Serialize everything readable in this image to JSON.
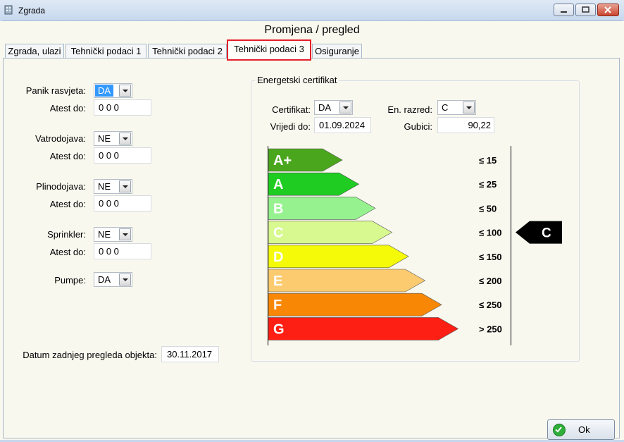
{
  "window": {
    "title": "Zgrada"
  },
  "form_title": "Promjena / pregled",
  "tabs": [
    {
      "label": "Zgrada, ulazi"
    },
    {
      "label": "Tehnički podaci 1"
    },
    {
      "label": "Tehnički podaci 2"
    },
    {
      "label": "Tehnički podaci 3"
    },
    {
      "label": "Osiguranje"
    }
  ],
  "left": {
    "panik": {
      "label": "Panik rasvjeta:",
      "value": "DA",
      "atest_label": "Atest do:",
      "atest_value": "0 0 0"
    },
    "vatro": {
      "label": "Vatrodojava:",
      "value": "NE",
      "atest_label": "Atest do:",
      "atest_value": "0 0 0"
    },
    "plino": {
      "label": "Plinodojava:",
      "value": "NE",
      "atest_label": "Atest do:",
      "atest_value": "0 0 0"
    },
    "sprinkler": {
      "label": "Sprinkler:",
      "value": "NE",
      "atest_label": "Atest do:",
      "atest_value": "0 0 0"
    },
    "pumpe": {
      "label": "Pumpe:",
      "value": "DA"
    },
    "datum": {
      "label": "Datum zadnjeg pregleda objekta:",
      "value": "30.11.2017"
    }
  },
  "energy": {
    "group_title": "Energetski certifikat",
    "certifikat_label": "Certifikat:",
    "certifikat_value": "DA",
    "vrijedi_label": "Vrijedi do:",
    "vrijedi_value": "01.09.2024",
    "razred_label": "En. razred:",
    "razred_value": "C",
    "gubici_label": "Gubici:",
    "gubici_value": "90,22",
    "classes": [
      {
        "name": "A+",
        "limit": "≤ 15",
        "color": "#4aa61c"
      },
      {
        "name": "A",
        "limit": "≤ 25",
        "color": "#1fcc21"
      },
      {
        "name": "B",
        "limit": "≤ 50",
        "color": "#96f28e"
      },
      {
        "name": "C",
        "limit": "≤ 100",
        "color": "#d8f98f"
      },
      {
        "name": "D",
        "limit": "≤ 150",
        "color": "#f4fa07"
      },
      {
        "name": "E",
        "limit": "≤ 200",
        "color": "#fccb70"
      },
      {
        "name": "F",
        "limit": "≤ 250",
        "color": "#f98706"
      },
      {
        "name": "G",
        "limit": "> 250",
        "color": "#fd1f13"
      }
    ],
    "current_class": "C",
    "current_class_index": 3
  },
  "ok_label": "Ok"
}
